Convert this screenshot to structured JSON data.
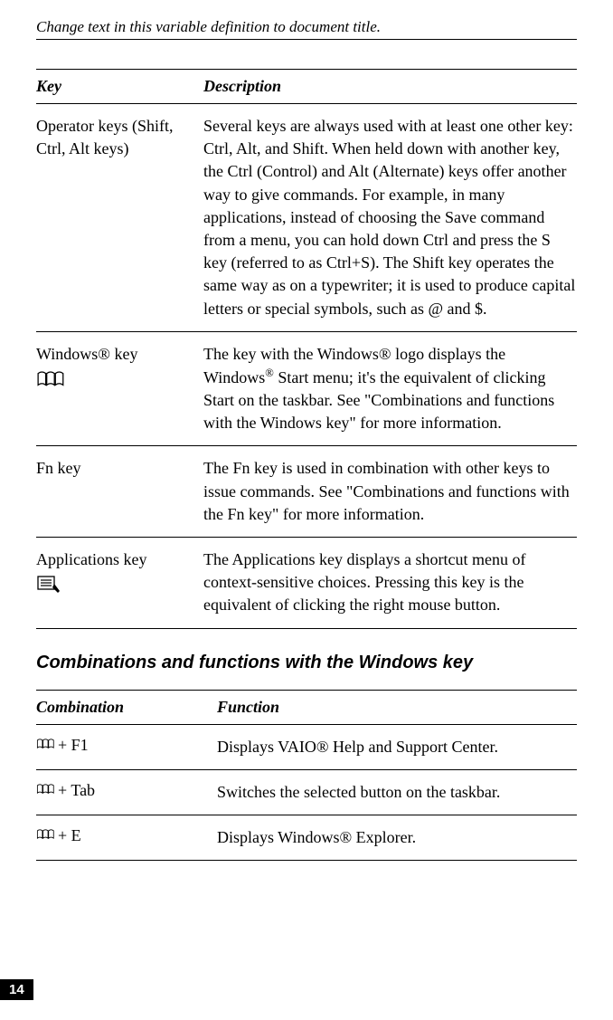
{
  "header": "Change text in this variable definition to document title.",
  "page_number": "14",
  "table1": {
    "header_key": "Key",
    "header_desc": "Description",
    "rows": [
      {
        "key": "Operator keys (Shift, Ctrl, Alt keys)",
        "desc": "Several keys are always used with at least one other key: Ctrl, Alt, and Shift. When held down with another key, the Ctrl (Control) and Alt (Alternate) keys offer another way to give commands. For example, in many applications, instead of choosing the Save command from a menu, you can hold down Ctrl and press the S key (referred to as Ctrl+S). The Shift key operates the same way as on a typewriter; it is used to produce capital letters or special symbols, such as @ and $."
      },
      {
        "key": "Windows® key",
        "desc_pre": "The key with the Windows® logo displays the Windows",
        "desc_post": " Start menu; it's the equivalent of clicking Start on the taskbar. See \"Combinations and functions with the Windows key\" for more information.",
        "sup": "®",
        "icon": "windows"
      },
      {
        "key": "Fn key",
        "desc": "The Fn key is used in combination with other keys to issue commands. See \"Combinations and functions with the Fn key\" for more information."
      },
      {
        "key": "Applications key",
        "desc": "The Applications key displays a shortcut menu of context-sensitive choices. Pressing this key is the equivalent of clicking the right mouse button.",
        "icon": "applications"
      }
    ]
  },
  "section_heading": "Combinations and functions with the Windows key",
  "table2": {
    "header_combo": "Combination",
    "header_func": "Function",
    "rows": [
      {
        "combo": "+ F1",
        "func": "Displays VAIO® Help and Support Center."
      },
      {
        "combo": "+ Tab",
        "func": "Switches the selected button on the taskbar."
      },
      {
        "combo": "+ E",
        "func": "Displays Windows® Explorer."
      }
    ]
  }
}
